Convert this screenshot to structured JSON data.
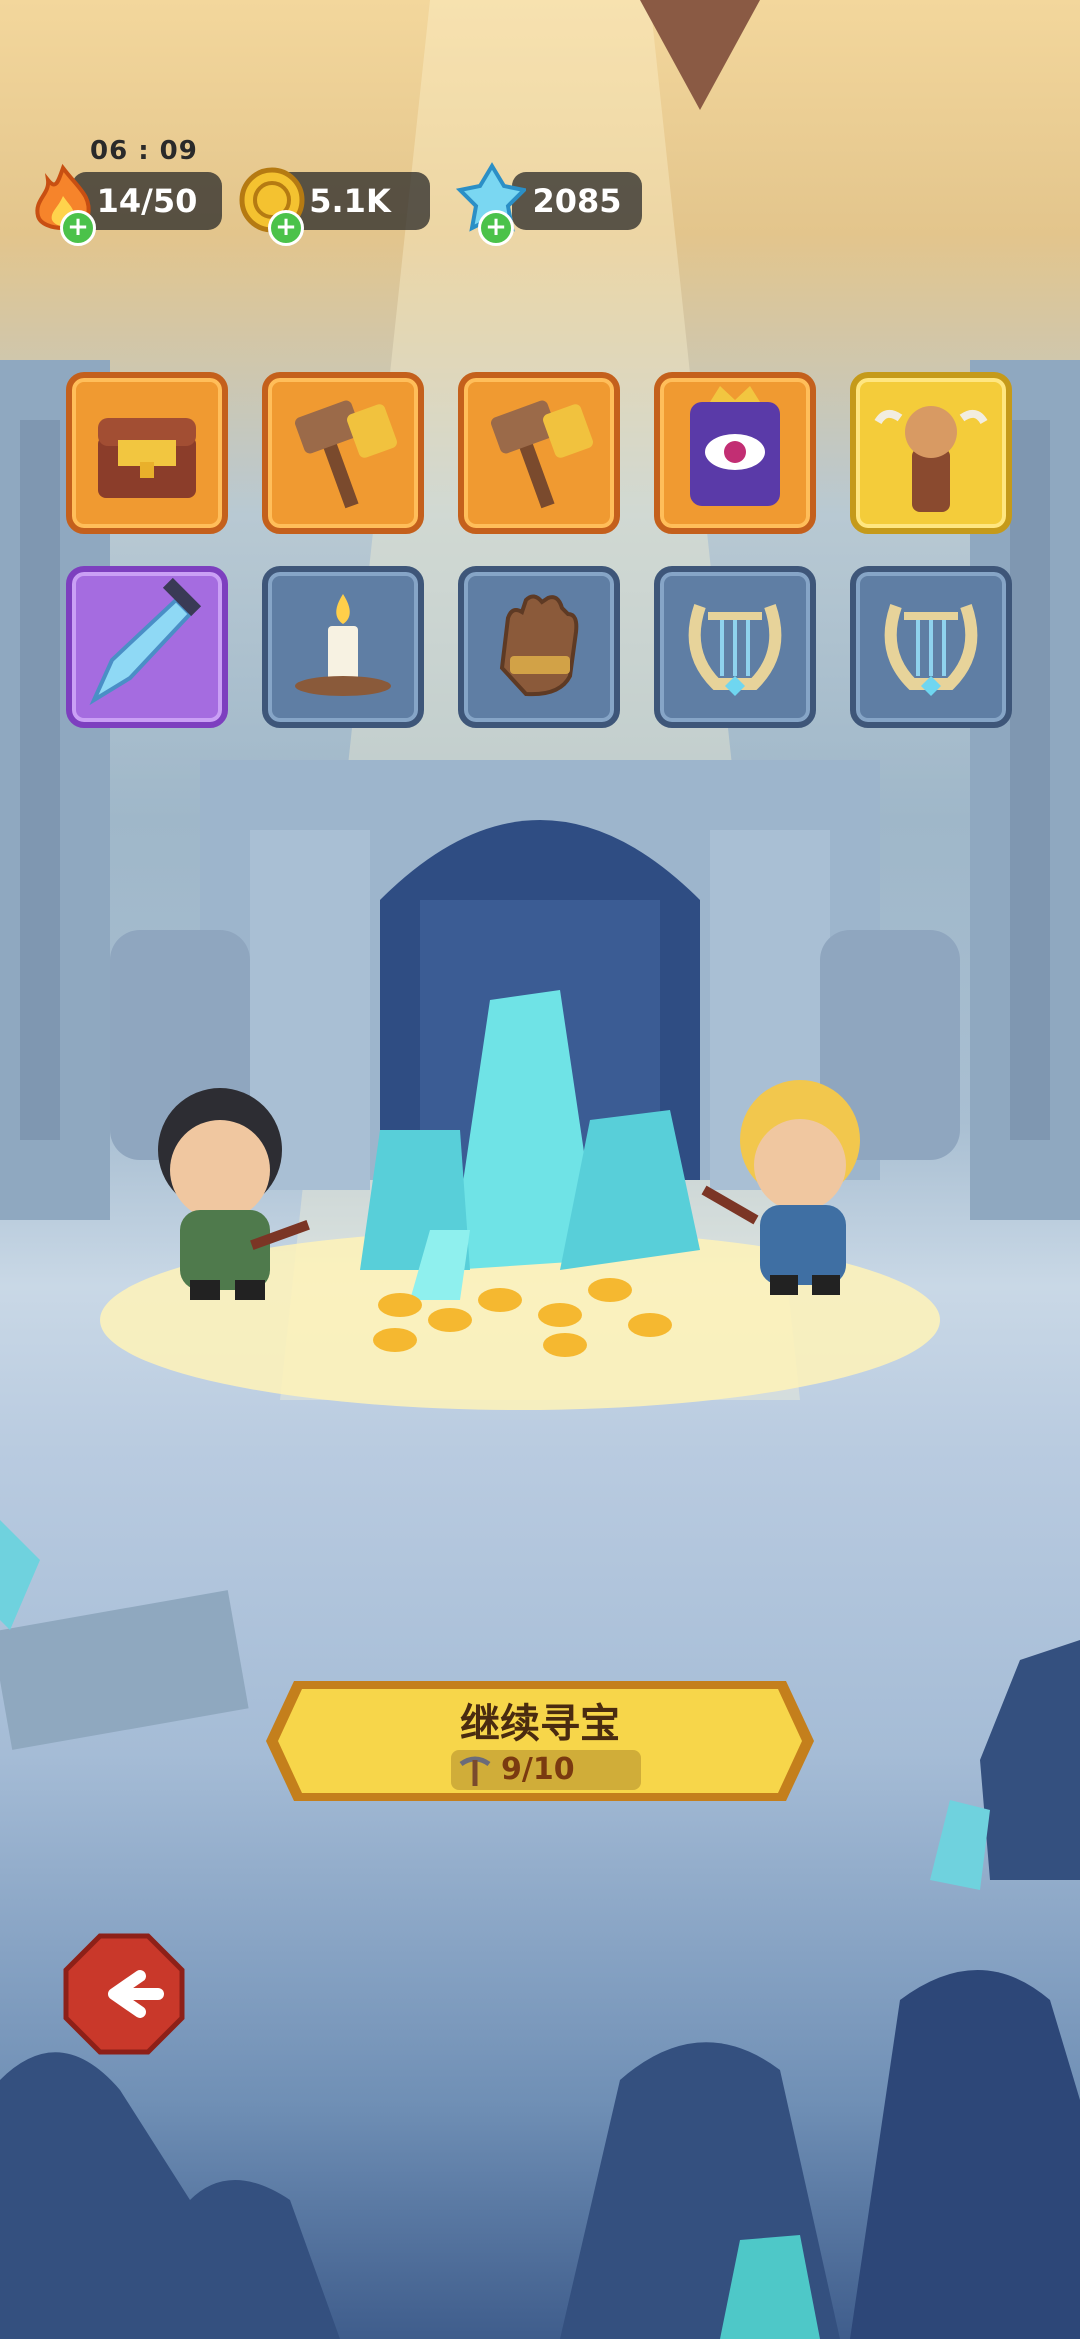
{
  "hud": {
    "clock": "06 : 09",
    "stamina": "14/50",
    "gold": "5.1K",
    "gems": "2085"
  },
  "items_row1": [
    {
      "icon": "treasure-chest-icon",
      "rarity": "orange"
    },
    {
      "icon": "war-hammer-icon",
      "rarity": "orange"
    },
    {
      "icon": "war-hammer-icon",
      "rarity": "orange"
    },
    {
      "icon": "eye-tome-icon",
      "rarity": "orange"
    },
    {
      "icon": "totem-icon",
      "rarity": "yellow"
    }
  ],
  "items_row2": [
    {
      "icon": "ice-sword-icon",
      "rarity": "purple"
    },
    {
      "icon": "candle-icon",
      "rarity": "blue"
    },
    {
      "icon": "leather-glove-icon",
      "rarity": "blue"
    },
    {
      "icon": "lyre-icon",
      "rarity": "blue"
    },
    {
      "icon": "lyre-icon",
      "rarity": "blue"
    }
  ],
  "action": {
    "continue_label": "继续寻宝",
    "progress": "9/10",
    "progress_current": 9,
    "progress_total": 10
  },
  "colors": {
    "button": "#f7d64a",
    "button_border": "#c47f1c",
    "back_button": "#c9382a"
  }
}
